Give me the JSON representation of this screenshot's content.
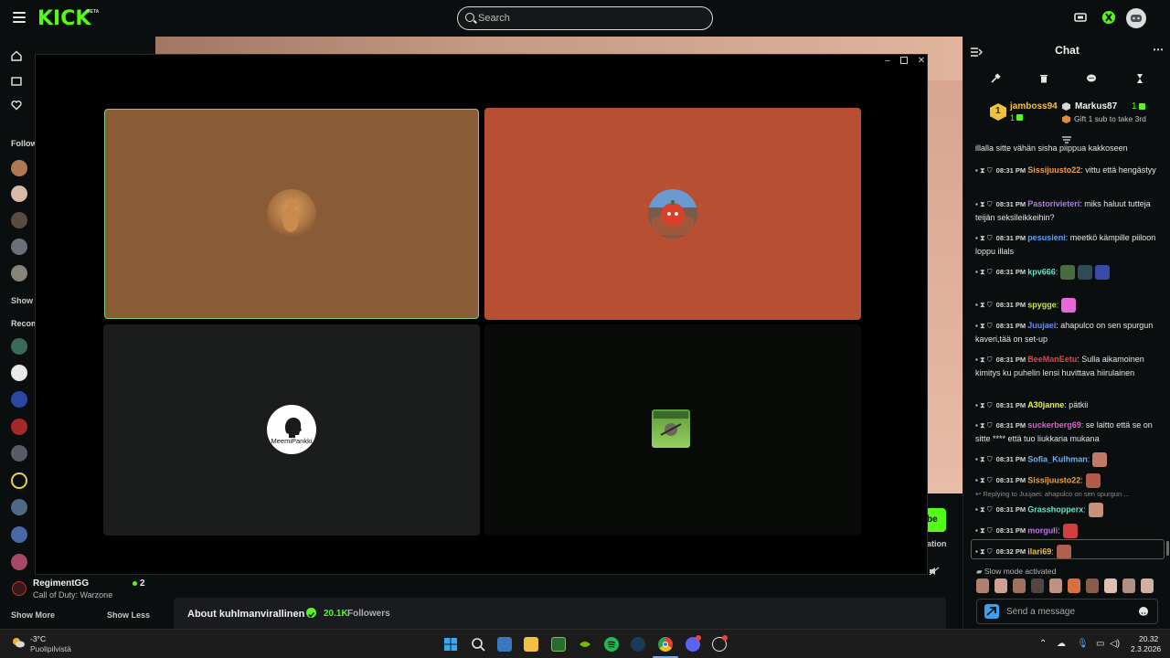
{
  "header": {
    "logo": "KICK",
    "logo_badge": "BETA",
    "search_placeholder": "Search"
  },
  "sidebar": {
    "followed_heading": "Follow",
    "recommended_heading": "Recom",
    "show_more_truncated": "Show M",
    "bottom_channel": {
      "name": "RegimentGG",
      "category": "Call of Duty: Warzone",
      "viewers": "2"
    },
    "show_more": "Show More",
    "show_less": "Show Less"
  },
  "below_stream": {
    "subscribe_fragment": "be",
    "donation_fragment": "ation",
    "about_title": "About kuhlmanvirallinen",
    "followers_count": "20.1K",
    "followers_label": "Followers"
  },
  "call_window": {
    "tiles": [
      {
        "color": "#8a5c35",
        "active": true,
        "avatar": "kangaroo-avatar"
      },
      {
        "color": "#b84f32",
        "active": false,
        "avatar": "tomato-avatar"
      },
      {
        "color": "#1a1d1c",
        "active": false,
        "avatar": "meemipankki-avatar",
        "avatar_text": "MeemiPankki"
      },
      {
        "color": "#080a08",
        "active": false,
        "avatar": "green-logo-avatar"
      }
    ]
  },
  "chat": {
    "title": "Chat",
    "leaderboard": {
      "first_rank": "1",
      "first_user": "jamboss94",
      "first_count": "1",
      "second_user": "Markus87",
      "second_count": "1",
      "gift_text": "Gift 1 sub to take 3rd"
    },
    "partial_message": "illalla sitte vähän sisha piippua kakkoseen",
    "messages": [
      {
        "time": "08:31 PM",
        "user": "Sissijuusto22",
        "color": "#f0a040",
        "text": " vittu että hengästyy"
      },
      {
        "time": "08:31 PM",
        "user": "Pastorivieteri",
        "color": "#b07af0",
        "text": " miks haluut tutteja teijän seksileikkeihin?"
      },
      {
        "time": "08:31 PM",
        "user": "pesusieni",
        "color": "#5aa0f0",
        "text": " meetkö kämpille piiloon loppu illals"
      },
      {
        "time": "08:31 PM",
        "user": "kpv666",
        "color": "#62e8c0",
        "text": ""
      },
      {
        "time": "08:31 PM",
        "user": "spygge",
        "color": "#c8e850",
        "text": ""
      },
      {
        "time": "08:31 PM",
        "user": "Juujaei",
        "color": "#6a8af0",
        "text": " ahapulco on sen spurgun kaveri,tää on set-up"
      },
      {
        "time": "08:31 PM",
        "user": "BeeManEetu",
        "color": "#f04040",
        "text": " Sulla aikamoinen kimitys ku puhelin lensi huvittava hiirulainen"
      },
      {
        "time": "08:31 PM",
        "user": "A30janne",
        "color": "#f0f040",
        "text": " pätkii"
      },
      {
        "time": "08:31 PM",
        "user": "suckerberg69",
        "color": "#e060d0",
        "text": " se laitto että se on sitte **** että tuo liukkaria mukana"
      },
      {
        "time": "08:31 PM",
        "user": "Sofia_Kulhman",
        "color": "#70b0f0",
        "text": ""
      },
      {
        "time": "08:31 PM",
        "user": "Sissijuusto22",
        "color": "#f0a040",
        "text": ""
      },
      {
        "time": "08:31 PM",
        "user": "Grasshopperx",
        "color": "#62e8c0",
        "text": ""
      },
      {
        "time": "08:31 PM",
        "user": "morguli",
        "color": "#c070f0",
        "text": ""
      },
      {
        "time": "08:32 PM",
        "user": "ilari69",
        "color": "#f0c040",
        "text": ""
      }
    ],
    "reply_text": "Replying to Juujaei: ahapulco on sen spurgun ...",
    "slow_mode": "Slow mode activated",
    "send_placeholder": "Send a message"
  },
  "taskbar": {
    "weather_temp": "-3°C",
    "weather_desc": "Puolipilvistä",
    "time": "20.32",
    "date": "2.3.2026"
  }
}
